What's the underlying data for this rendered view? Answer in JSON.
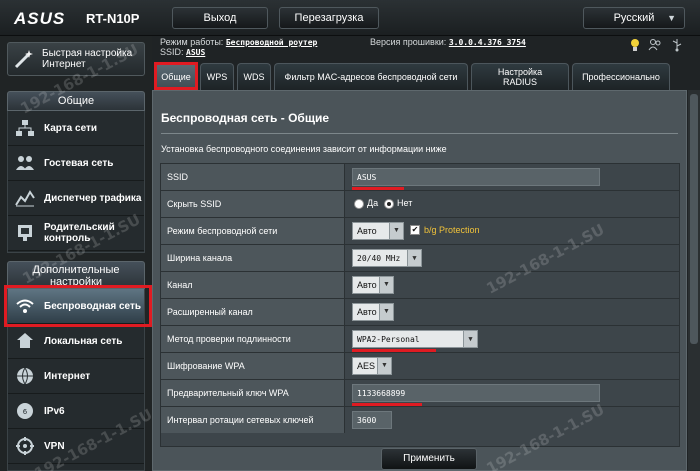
{
  "header": {
    "logo": "ASUS",
    "model": "RT-N10P",
    "logout_label": "Выход",
    "reboot_label": "Перезагрузка",
    "language": "Русский"
  },
  "info": {
    "mode_label": "Режим работы:",
    "mode_value": "Беспроводной роутер",
    "firmware_label": "Версия прошивки:",
    "firmware_value": "3.0.0.4.376_3754",
    "ssid_label": "SSID:",
    "ssid_value": "ASUS"
  },
  "sidebar": {
    "quick_setup": "Быстрая настройка Интернет",
    "general_title": "Общие",
    "general_items": [
      {
        "label": "Карта сети",
        "icon": "network-map-icon"
      },
      {
        "label": "Гостевая сеть",
        "icon": "guest-network-icon"
      },
      {
        "label": "Диспетчер трафика",
        "icon": "traffic-manager-icon"
      },
      {
        "label": "Родительский контроль",
        "icon": "parental-control-icon"
      }
    ],
    "extra_title": "Дополнительные настройки",
    "extra_items": [
      {
        "label": "Беспроводная сеть",
        "icon": "wireless-icon",
        "active": true
      },
      {
        "label": "Локальная сеть",
        "icon": "lan-icon"
      },
      {
        "label": "Интернет",
        "icon": "internet-icon"
      },
      {
        "label": "IPv6",
        "icon": "ipv6-icon"
      },
      {
        "label": "VPN",
        "icon": "vpn-icon"
      }
    ]
  },
  "tabs": [
    {
      "label": "Общие",
      "active": true
    },
    {
      "label": "WPS"
    },
    {
      "label": "WDS"
    },
    {
      "label": "Фильтр MAC-адресов беспроводной сети"
    },
    {
      "label": "Настройка RADIUS"
    },
    {
      "label": "Профессионально"
    }
  ],
  "panel": {
    "title": "Беспроводная сеть - Общие",
    "description": "Установка беспроводного соединения зависит от информации ниже",
    "rows": {
      "ssid": {
        "label": "SSID",
        "value": "ASUS"
      },
      "hide_ssid": {
        "label": "Скрыть SSID",
        "yes": "Да",
        "no": "Нет",
        "selected": "Нет"
      },
      "mode": {
        "label": "Режим беспроводной сети",
        "value": "Авто",
        "bg_protection": "b/g Protection"
      },
      "width": {
        "label": "Ширина канала",
        "value": "20/40 MHz"
      },
      "channel": {
        "label": "Канал",
        "value": "Авто"
      },
      "ext_channel": {
        "label": "Расширенный канал",
        "value": "Авто"
      },
      "auth": {
        "label": "Метод проверки подлинности",
        "value": "WPA2-Personal"
      },
      "encryption": {
        "label": "Шифрование WPA",
        "value": "AES"
      },
      "psk": {
        "label": "Предварительный ключ WPA",
        "value": "1133668899"
      },
      "rotation": {
        "label": "Интервал ротации сетевых ключей",
        "value": "3600"
      }
    },
    "apply_label": "Применить"
  },
  "watermark": "192-168-1-1.SU",
  "colors": {
    "highlight": "#e01b22",
    "panel": "#4b5459",
    "background": "#1f2325"
  }
}
